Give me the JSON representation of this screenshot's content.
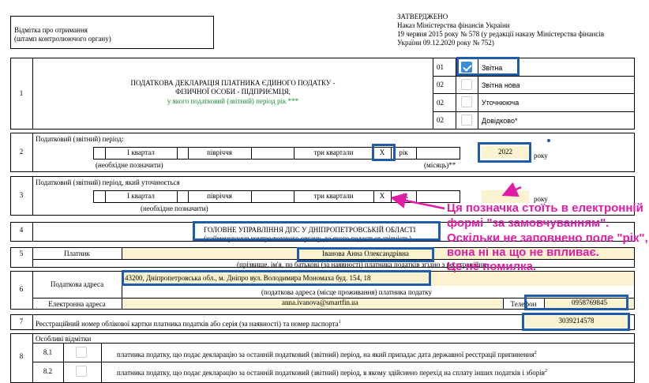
{
  "header": {
    "receipt_mark": "Відмітка про отримання",
    "receipt_stamp": "(штамп контролюючого органу)",
    "approved": "ЗАТВЕРДЖЕНО",
    "order_line1": "Наказ Міністерства фінансів України",
    "order_line2": "19 червня 2015 року № 578 (у редакції наказу Міністерства фінансів",
    "order_line3": "України 09.12.2020 року № 752)"
  },
  "row1": {
    "num": "1",
    "title_line1": "ПОДАТКОВА ДЕКЛАРАЦІЯ ПЛАТНИКА ЄДИНОГО ПОДАТКУ -",
    "title_line2": "ФІЗИЧНОЇ ОСОБИ - ПІДПРИЄМЦЯ,",
    "title_line3": "у якого податковий (звітний) період рік ***",
    "types": [
      {
        "code": "01",
        "label": "Звітна",
        "checked": true
      },
      {
        "code": "02",
        "label": "Звітна нова",
        "checked": false
      },
      {
        "code": "02",
        "label": "Уточнююча",
        "checked": false
      },
      {
        "code": "02",
        "label": "Довідково*",
        "checked": false
      }
    ]
  },
  "row2": {
    "num": "2",
    "label": "Податковий (звітний) період:",
    "q1": "I квартал",
    "half": "півріччя",
    "q3": "три квартали",
    "x": "X",
    "year_word": "рік",
    "required": "(необхідне позначити)",
    "month": "(місяць)**",
    "year": "2022",
    "year_suffix": "року"
  },
  "row3": {
    "num": "3",
    "label": "Податковий (звітний) період, який уточнюється",
    "q1": "I квартал",
    "half": "півріччя",
    "q3": "три квартали",
    "x": "X",
    "year_word": "рік",
    "required": "(необхідне позначити)",
    "year_suffix": "року"
  },
  "row4": {
    "num": "4",
    "authority": "ГОЛОВНЕ УПРАВЛІННЯ ДПС У ДНІПРОПЕТРОВСЬКІЙ ОБЛАСТІ",
    "caption": "(найменування контролюючого органу, до якого подається звітність)"
  },
  "row5": {
    "num": "5",
    "label": "Платник",
    "name": "Іванова Анна Олександрівна",
    "caption": "(прізвище, ім'я, по батькові (за наявності) платника податків згідно з реєстраційни"
  },
  "row6": {
    "num": "6",
    "address_label": "Податкова адреса",
    "address": "43200, Дніпропетровська обл., м. Дніпро вул. Володимира Мономаха буд. 154, 18",
    "address_caption": "(податкова адреса (місце проживання) платника податку",
    "email_label": "Електронна адреса",
    "email": "anna.ivanova@smartfin.ua",
    "phone_label": "Телефон",
    "phone": "0958769845"
  },
  "row7": {
    "num": "7",
    "label": "Реєстраційний номер облікової картки платника податків або серія (за наявності) та номер паспорта",
    "sup": "1",
    "value": "3039214578"
  },
  "row8": {
    "num": "8",
    "label": "Особливі відмітки",
    "items": [
      {
        "code": "8.1",
        "text": "платника податку, що подає декларацію за останній податковий (звітний) період, на який припадає дата державної реєстрації припинення",
        "sup": "2"
      },
      {
        "code": "8.2",
        "text": "платника податку, що подає декларацію за останній податковий (звітний) період, в якому здійснено перехід на сплату інших податків і зборів",
        "sup": "2"
      }
    ]
  },
  "annotation": {
    "line1": "Ця позначка стоїть в електронній",
    "line2": "формі \"за замовчуванням\".",
    "line3": "Оскільки не заповнено поле \"рік\",",
    "line4": "вона ні на що не впливає.",
    "line5": "Це не помилка."
  },
  "colors": {
    "highlight_blue": "#1f5dab",
    "annotation_pink": "#e21ba7",
    "field_yellow": "#fbf3cf",
    "check_blue": "#3c8ad9",
    "title_green": "#1b8a2f"
  }
}
